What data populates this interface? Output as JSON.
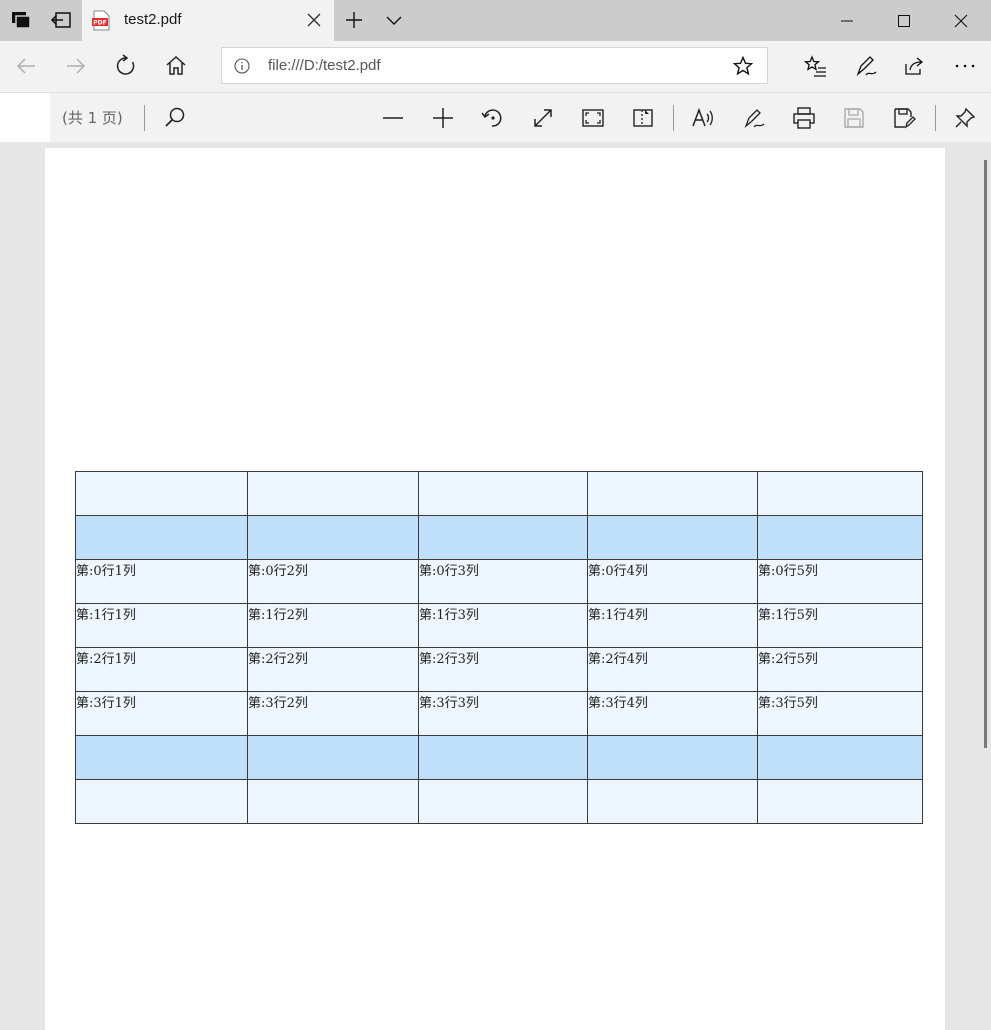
{
  "tab": {
    "title": "test2.pdf",
    "icon": "pdf-file-icon"
  },
  "address": {
    "url": "file:///D:/test2.pdf"
  },
  "pdf_toolbar": {
    "page_count": "(共 1 页)"
  },
  "colors": {
    "row_light": "#eef6ff",
    "row_blue": "#bfdffa",
    "border": "#3a3a3a"
  },
  "table": {
    "rows": [
      {
        "style": "light",
        "cells": [
          "",
          "",
          "",
          "",
          ""
        ]
      },
      {
        "style": "blue",
        "cells": [
          "",
          "",
          "",
          "",
          ""
        ]
      },
      {
        "style": "light",
        "cells": [
          "第:0行1列",
          "第:0行2列",
          "第:0行3列",
          "第:0行4列",
          "第:0行5列"
        ]
      },
      {
        "style": "light",
        "cells": [
          "第:1行1列",
          "第:1行2列",
          "第:1行3列",
          "第:1行4列",
          "第:1行5列"
        ]
      },
      {
        "style": "light",
        "cells": [
          "第:2行1列",
          "第:2行2列",
          "第:2行3列",
          "第:2行4列",
          "第:2行5列"
        ]
      },
      {
        "style": "light",
        "cells": [
          "第:3行1列",
          "第:3行2列",
          "第:3行3列",
          "第:3行4列",
          "第:3行5列"
        ]
      },
      {
        "style": "blue",
        "cells": [
          "",
          "",
          "",
          "",
          ""
        ]
      },
      {
        "style": "light",
        "cells": [
          "",
          "",
          "",
          "",
          ""
        ]
      }
    ]
  }
}
